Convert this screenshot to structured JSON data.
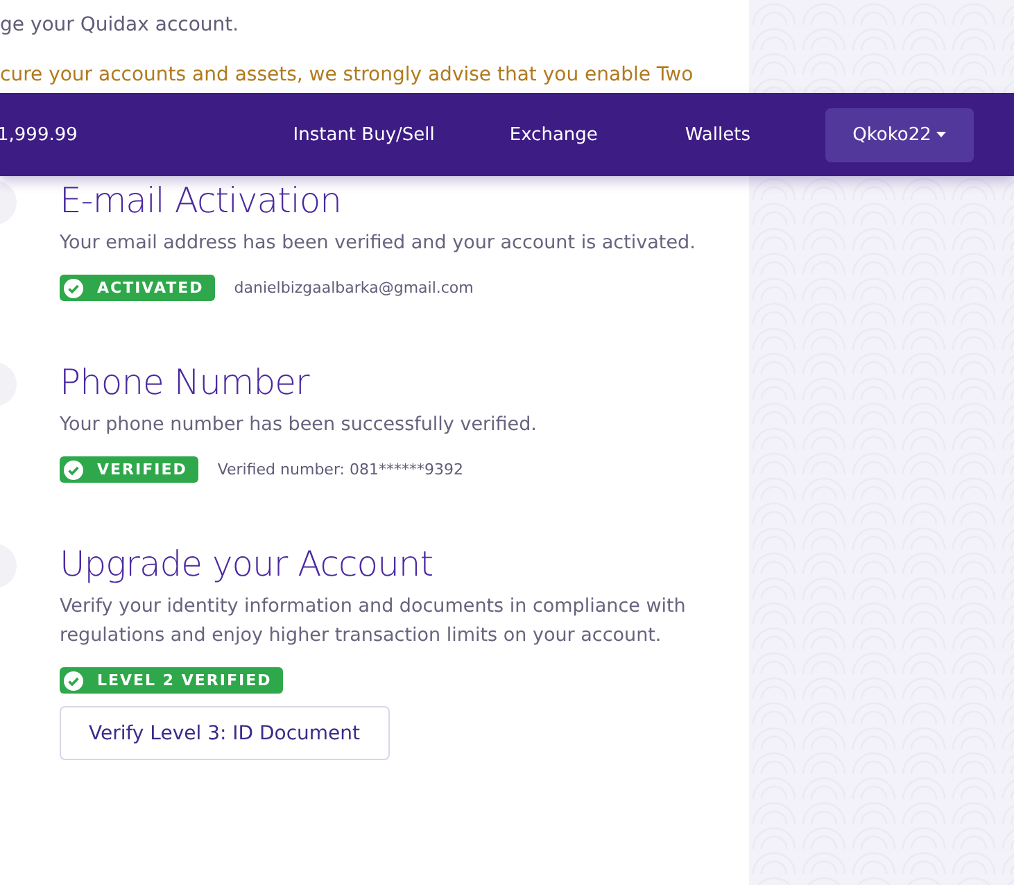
{
  "intro": {
    "text": "ge your Quidax account.",
    "notice": "cure your accounts and assets, we strongly advise that you enable Two"
  },
  "navbar": {
    "balance": "1,999.99",
    "links": [
      "Instant Buy/Sell",
      "Exchange",
      "Wallets"
    ],
    "user": "Qkoko22"
  },
  "sections": [
    {
      "title": "E-mail Activation",
      "description": "Your email address has been verified and your account is activated.",
      "badge": {
        "label": "ACTIVATED",
        "verified": true
      },
      "detail": "danielbizgaalbarka@gmail.com"
    },
    {
      "title": "Phone Number",
      "description": "Your phone number has been successfully verified.",
      "badge": {
        "label": "VERIFIED",
        "verified": true
      },
      "detail": "Verified number: 081******9392"
    },
    {
      "title": "Upgrade your Account",
      "description": "Verify your identity information and documents in compliance with regulations and enjoy higher transaction limits on your account.",
      "badge": {
        "label": "LEVEL 2 VERIFIED",
        "verified": true
      },
      "button": "Verify Level 3: ID Document"
    }
  ]
}
